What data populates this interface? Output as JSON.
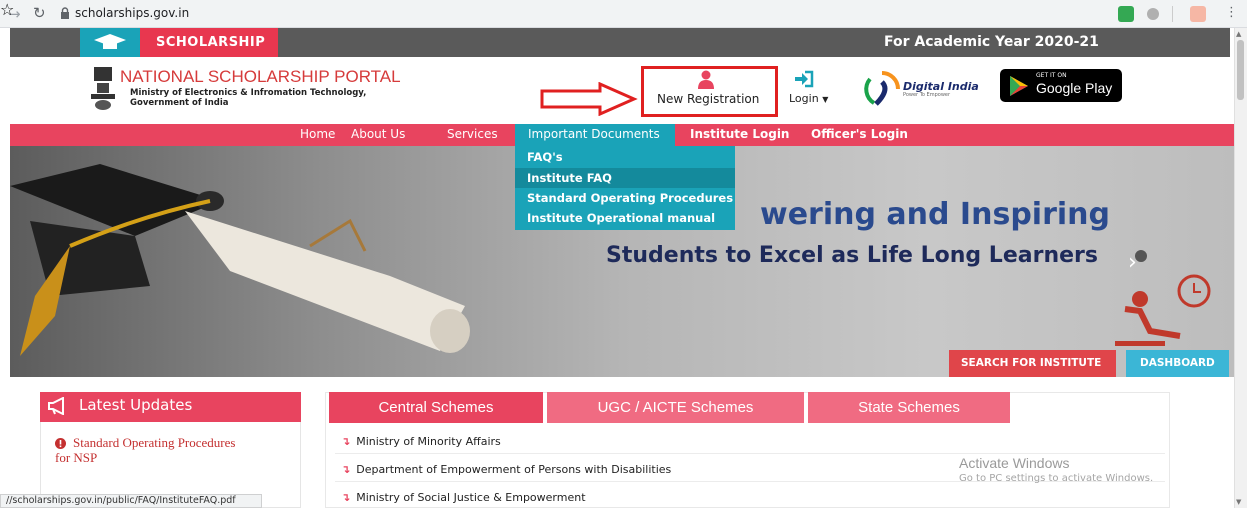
{
  "browser": {
    "url": "scholarships.gov.in",
    "status_url": "//scholarships.gov.in/public/FAQ/InstituteFAQ.pdf"
  },
  "topbar": {
    "scholarship_label": "SCHOLARSHIP",
    "academic_year": "For Academic Year 2020-21"
  },
  "header": {
    "portal_title": "NATIONAL SCHOLARSHIP PORTAL",
    "ministry_line": "Ministry of Electronics & Infromation Technology,",
    "government_line": "Government of India",
    "new_registration": "New Registration",
    "login": "Login",
    "digital_india": "Digital India",
    "digital_india_tagline": "Power To Empower",
    "google_play_get": "GET IT ON",
    "google_play_name": "Google Play"
  },
  "nav": {
    "items": [
      "Home",
      "About Us",
      "Services",
      "Important Documents",
      "Institute Login",
      "Officer's Login"
    ]
  },
  "dropdown": {
    "items": [
      "FAQ's",
      "Institute FAQ",
      "Standard Operating Procedures",
      "Institute Operational manual"
    ]
  },
  "hero": {
    "line1": "wering and Inspiring",
    "line2": "Students to Excel as Life Long Learners",
    "search_button": "SEARCH FOR INSTITUTE",
    "dashboard_button": "DASHBOARD"
  },
  "latest_updates": {
    "title": "Latest Updates",
    "item1_line1": "Standard Operating Procedures",
    "item1_line2": "for NSP"
  },
  "schemes": {
    "tabs": [
      "Central Schemes",
      "UGC / AICTE Schemes",
      "State Schemes"
    ],
    "rows": [
      "Ministry of Minority Affairs",
      "Department of Empowerment of Persons with Disabilities",
      "Ministry of Social Justice & Empowerment"
    ]
  },
  "watermark": {
    "line1": "Activate Windows",
    "line2": "Go to PC settings to activate Windows."
  },
  "colors": {
    "brand_red": "#e8445f",
    "teal": "#1aa3b8",
    "callout_red": "#e02020"
  }
}
